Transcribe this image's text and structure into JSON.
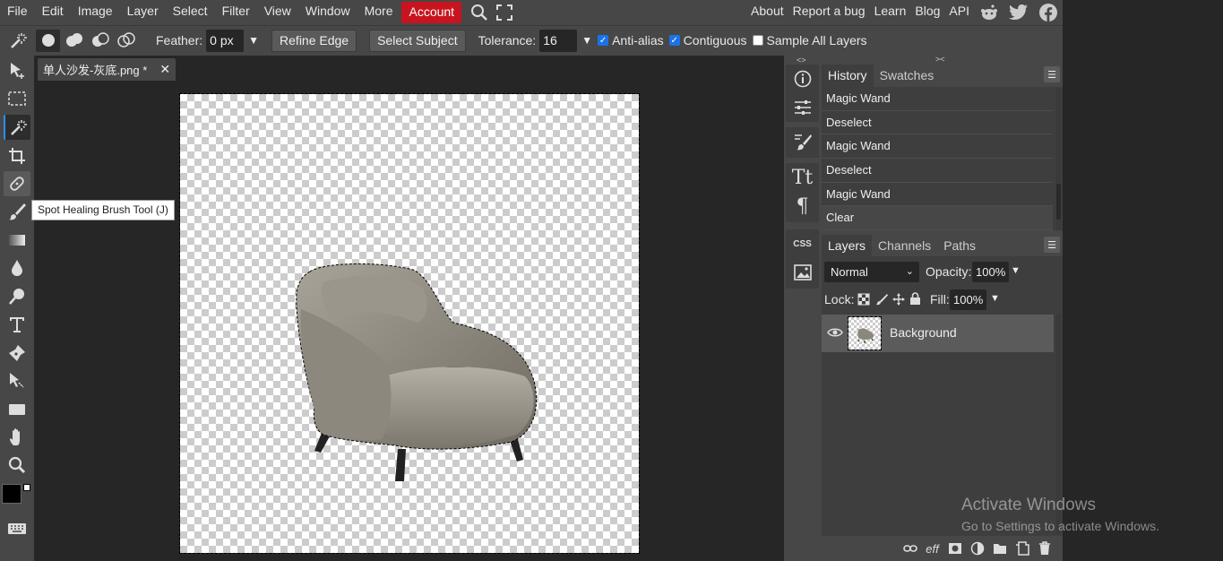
{
  "menu": {
    "items": [
      "File",
      "Edit",
      "Image",
      "Layer",
      "Select",
      "Filter",
      "View",
      "Window",
      "More"
    ],
    "account": "Account",
    "right_links": [
      "About",
      "Report a bug",
      "Learn",
      "Blog",
      "API"
    ],
    "icons": [
      "search-icon",
      "fullscreen-icon"
    ],
    "social": [
      "reddit-icon",
      "twitter-icon",
      "facebook-icon"
    ]
  },
  "options": {
    "feather_label": "Feather:",
    "feather_value": "0 px",
    "refine_edge": "Refine Edge",
    "select_subject": "Select Subject",
    "tolerance_label": "Tolerance:",
    "tolerance_value": "16",
    "anti_alias": "Anti-alias",
    "contiguous": "Contiguous",
    "sample_all_layers": "Sample All Layers",
    "anti_alias_checked": true,
    "contiguous_checked": true,
    "sample_all_checked": false
  },
  "toolbar": {
    "active_tool": "magic-wand",
    "tooltip": "Spot Healing Brush Tool (J)",
    "foreground_color": "#000000",
    "background_color": "#ffffff"
  },
  "document": {
    "tab_title": "单人沙发-灰底.png *",
    "close_symbol": "✕"
  },
  "history": {
    "tabs": [
      "History",
      "Swatches"
    ],
    "entries": [
      "Magic Wand",
      "Deselect",
      "Magic Wand",
      "Deselect",
      "Magic Wand",
      "Clear"
    ]
  },
  "layers": {
    "tabs": [
      "Layers",
      "Channels",
      "Paths"
    ],
    "blend_mode": "Normal",
    "opacity_label": "Opacity:",
    "opacity_value": "100%",
    "lock_label": "Lock:",
    "fill_label": "Fill:",
    "fill_value": "100%",
    "items": [
      {
        "name": "Background",
        "visible": true
      }
    ]
  },
  "watermark": {
    "title": "Activate Windows",
    "subtitle": "Go to Settings to activate Windows."
  },
  "colors": {
    "accent": "#2c8ff5",
    "account_red": "#c8141e",
    "panel": "#474747",
    "workspace": "#262626"
  }
}
